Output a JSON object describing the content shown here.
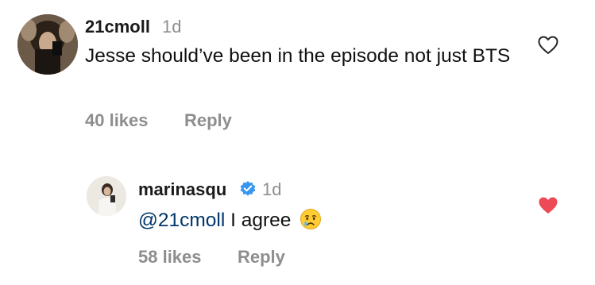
{
  "comments": [
    {
      "username": "21cmoll",
      "time": "1d",
      "text": "Jesse should’ve been in the episode not just BTS",
      "likes": "40 likes",
      "reply": "Reply",
      "liked": false
    },
    {
      "username": "marinasqu",
      "time": "1d",
      "mention": "@21cmoll",
      "text": "I agree",
      "emoji": "crying-face-emoji",
      "verified": true,
      "likes": "58 likes",
      "reply": "Reply",
      "liked": true
    }
  ],
  "colors": {
    "heart_liked": "#ed4956",
    "heart_outline": "#262626",
    "verified_blue": "#3897f0",
    "mention": "#00376b",
    "secondary_text": "#8e8e8e"
  }
}
